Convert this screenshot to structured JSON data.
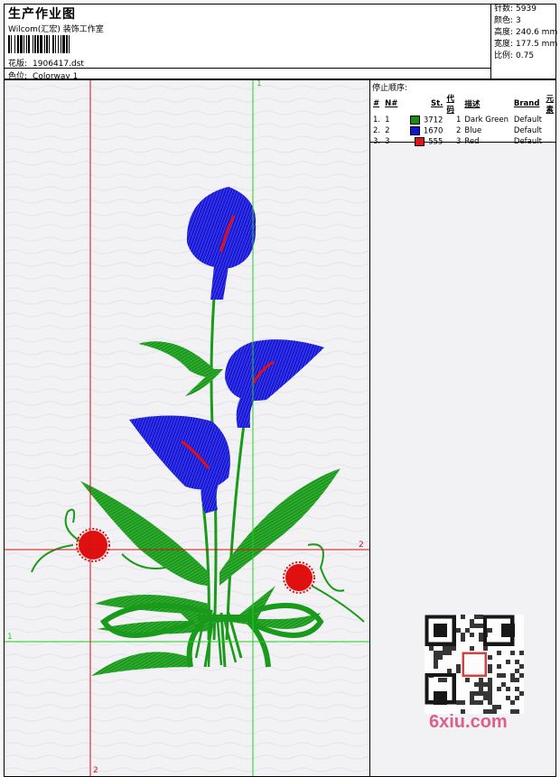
{
  "header": {
    "title": "生产作业图",
    "company": "Wilcom(汇宏) 装饰工作室",
    "design_label": "花版:",
    "design_value": "1906417.dst",
    "colorway_label": "色位:",
    "colorway_value": "Colorway 1"
  },
  "stats": [
    {
      "label": "针数:",
      "value": "5939"
    },
    {
      "label": "颜色:",
      "value": "3"
    },
    {
      "label": "高度:",
      "value": "240.6 mm"
    },
    {
      "label": "宽度:",
      "value": "177.5 mm"
    },
    {
      "label": "比例:",
      "value": "0.75"
    }
  ],
  "stop_sequence": {
    "title": "停止顺序:",
    "headers": [
      "#",
      "N#",
      "St.",
      "代码",
      "描述",
      "Brand",
      "元素"
    ],
    "rows": [
      {
        "num": "1.",
        "n": "1",
        "color": "#1a8c1a",
        "stitches": "3712",
        "code": "1",
        "desc": "Dark Green",
        "brand": "Default"
      },
      {
        "num": "2.",
        "n": "2",
        "color": "#1414d2",
        "stitches": "1670",
        "code": "2",
        "desc": "Blue",
        "brand": "Default"
      },
      {
        "num": "3.",
        "n": "3",
        "color": "#e01414",
        "stitches": "555",
        "code": "3",
        "desc": "Red",
        "brand": "Default"
      }
    ]
  },
  "guides": {
    "green_v": "1",
    "green_h": "1",
    "red_v": "2",
    "red_h": "2"
  },
  "watermark": "6xiu.com",
  "colors": {
    "green": "#1a9a1a",
    "blue": "#1a1ad8",
    "red": "#e01010",
    "guide_green": "#22cc22",
    "guide_red": "#d01010"
  }
}
